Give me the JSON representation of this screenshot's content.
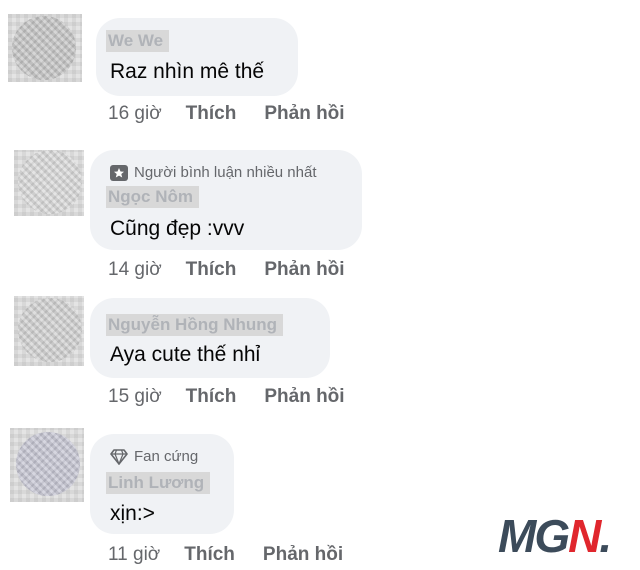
{
  "comments": [
    {
      "name": "We We",
      "badge": "",
      "text": "Raz nhìn mê thế",
      "time": "16 giờ",
      "like": "Thích",
      "reply": "Phản hồi"
    },
    {
      "name": "Ngọc Nôm",
      "badge": "Người bình luận nhiều nhất",
      "badge_icon": "star-badge-icon",
      "text": "Cũng đẹp :vvv",
      "time": "14 giờ",
      "like": "Thích",
      "reply": "Phản hồi"
    },
    {
      "name": "Nguyễn Hồng Nhung",
      "badge": "",
      "text": "Aya cute thế nhỉ",
      "time": "15 giờ",
      "like": "Thích",
      "reply": "Phản hồi"
    },
    {
      "name": "Linh Lương",
      "badge": "Fan cứng",
      "badge_icon": "diamond-icon",
      "text": "xịn:>",
      "time": "11 giờ",
      "like": "Thích",
      "reply": "Phản hồi"
    }
  ],
  "watermark": {
    "text_dark": "MG",
    "text_red": "N",
    "dot": ".",
    "colors": {
      "dark": "#3c4b5a",
      "red": "#e0262d"
    }
  },
  "colors": {
    "bubble": "#f0f2f5",
    "meta_text": "#65676b",
    "body_text": "#050505"
  }
}
